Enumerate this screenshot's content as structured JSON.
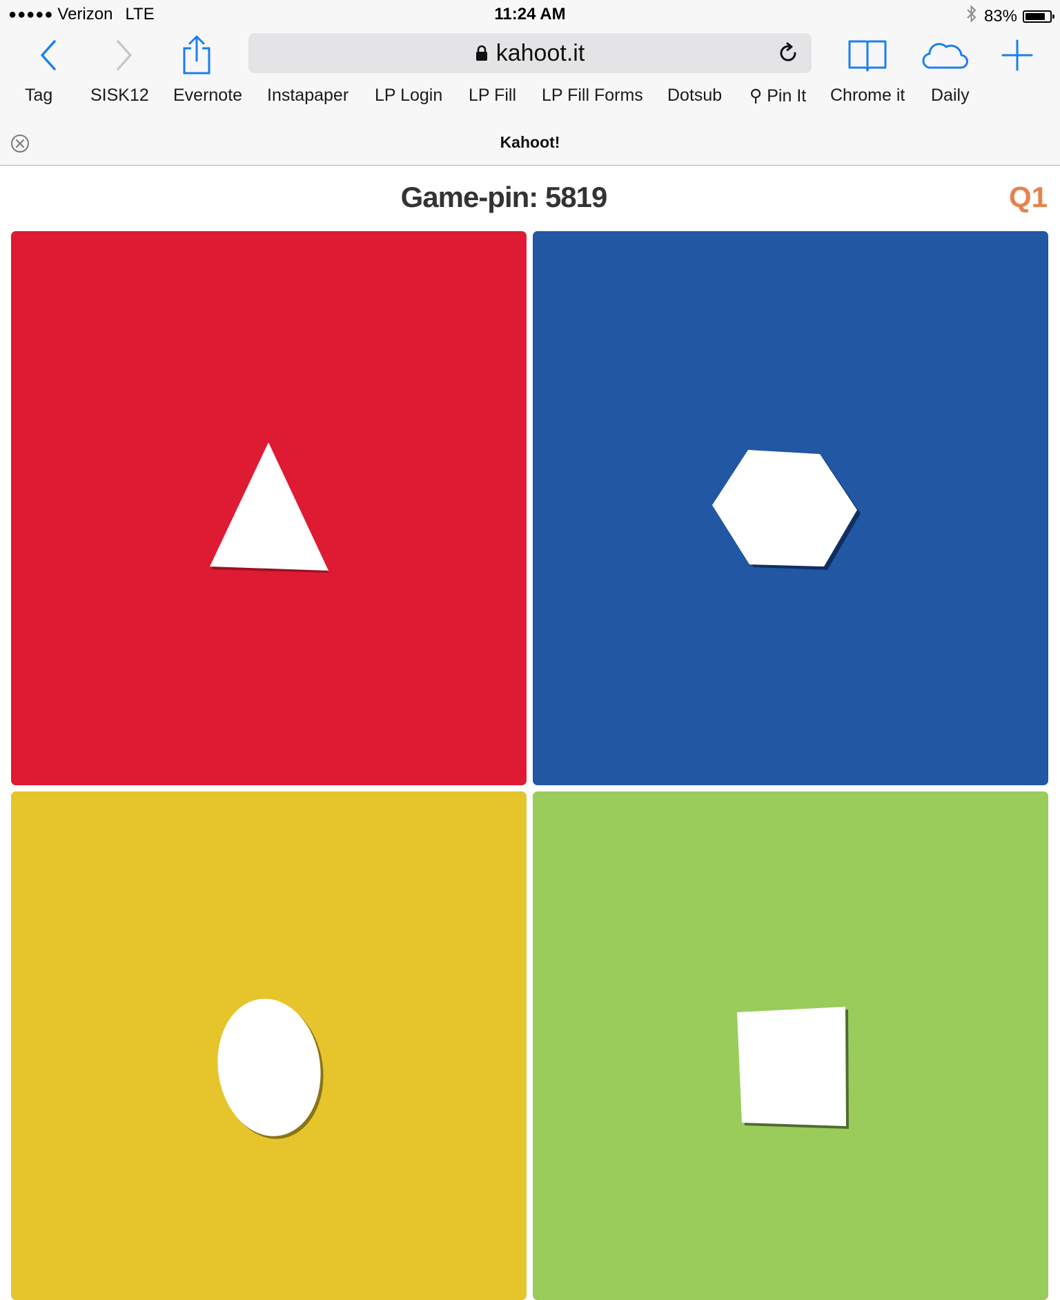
{
  "status_bar": {
    "carrier": "Verizon",
    "network": "LTE",
    "signal_dots": "●●●●●",
    "time": "11:24 AM",
    "bluetooth_icon": "bluetooth-icon",
    "battery_percent": "83%",
    "battery_level": 0.83
  },
  "toolbar": {
    "back_icon": "chevron-left-icon",
    "forward_icon": "chevron-right-icon",
    "share_icon": "share-icon",
    "url": "kahoot.it",
    "lock_icon": "lock-icon",
    "reload_icon": "reload-icon",
    "bookmarks_icon": "book-icon",
    "cloud_icon": "cloud-icon",
    "new_tab_icon": "plus-icon",
    "accent_color": "#1a7ef2"
  },
  "bookmarks": [
    "Tag",
    "SISK12",
    "Evernote",
    "Instapaper",
    "LP Login",
    "LP Fill",
    "LP Fill Forms",
    "Dotsub",
    "⚲ Pin It",
    "Chrome it",
    "Daily"
  ],
  "tab": {
    "title": "Kahoot!",
    "close_icon": "close-circle-icon"
  },
  "game": {
    "pin_label": "Game-pin: 5819",
    "question": "Q1",
    "question_color": "#e8814a"
  },
  "answers": [
    {
      "shape": "triangle",
      "color": "#df1a33",
      "shape_icon": "triangle-icon"
    },
    {
      "shape": "hexagon",
      "color": "#2157a3",
      "shape_icon": "hexagon-icon"
    },
    {
      "shape": "circle",
      "color": "#e5c52b",
      "shape_icon": "circle-icon"
    },
    {
      "shape": "square",
      "color": "#99cc5b",
      "shape_icon": "square-icon"
    }
  ]
}
